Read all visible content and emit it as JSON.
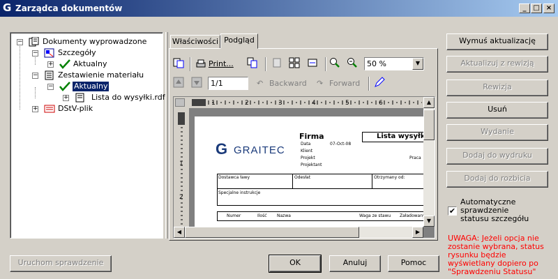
{
  "window": {
    "title": "Zarządca dokumentów",
    "min": "_",
    "max": "□",
    "close": "×"
  },
  "tree": {
    "root": "Dokumenty wyprowadzone",
    "szczegoly": "Szczegóły",
    "szczegoly_aktualny": "Aktualny",
    "zestawienie": "Zestawienie materiału",
    "zest_aktualny": "Aktualny",
    "lista": "Lista do wysyłki.rdf",
    "dstv": "DStV-plik"
  },
  "tabs": [
    {
      "label": "Właściwości"
    },
    {
      "label": "Podgląd"
    }
  ],
  "toolbar": {
    "print": "Print...",
    "zoom": "50 %",
    "page": "1/1",
    "backward": "Backward",
    "forward": "Forward"
  },
  "ruler": {
    "top": [
      "1",
      "2",
      "3",
      "4",
      "5",
      "6"
    ],
    "left": [
      "1",
      "2"
    ]
  },
  "preview": {
    "company": "Firma",
    "logo_text": "GRAITEC",
    "data_label": "Data",
    "date_value": "07-Oct-08",
    "klient": "Klient",
    "projekt": "Projekt",
    "projektant": "Projektant",
    "title_box": "Lista wysyłko",
    "praca": "Praca",
    "dostawca": "Dostawca ławy",
    "odeslat": "Odesłat",
    "otrzymany": "Otrzymany od:",
    "specjalne": "Specjalne instrukcje",
    "col_numer": "Numer",
    "col_ilosc": "Ilość",
    "col_nazwa": "Nazwa",
    "col_waga": "Waga ze stawu",
    "col_zaladowany": "Załadowany"
  },
  "right_buttons": {
    "wymus": "Wymuś aktualizację",
    "aktualizuj": "Aktualizuj z rewizją",
    "rewizja": "Rewizja",
    "usun": "Usuń",
    "wydanie": "Wydanie",
    "dodaj_wydruku": "Dodaj do wydruku",
    "dodaj_rozbicia": "Dodaj do rozbicia"
  },
  "auto_check": {
    "label": "Automatyczne sprawdzenie statusu szczegółu",
    "checked": true,
    "mark": "✔"
  },
  "warning": {
    "text": "UWAGA: Jeżeli opcja nie zostanie wybrana, status rysunku będzie wyświetlany dopiero po \"Sprawdzeniu Statusu\"",
    "color": "#ff0000"
  },
  "bottom": {
    "uruchom": "Uruchom sprawdzenie",
    "ok": "OK",
    "anuluj": "Anuluj",
    "pomoc": "Pomoc"
  }
}
